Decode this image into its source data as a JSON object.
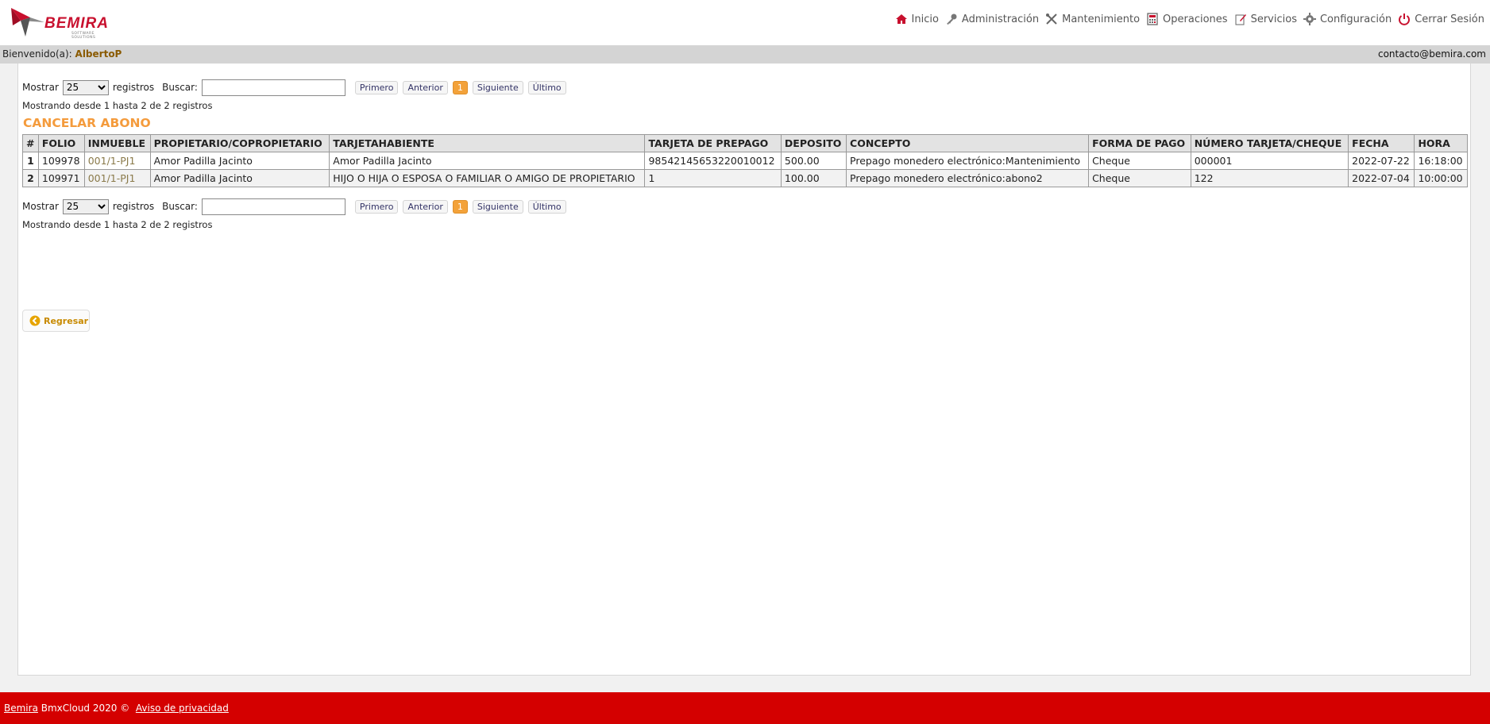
{
  "brand": {
    "logo_text": "BEMIRA",
    "logo_tagline": "SOFTWARE SOLUTIONS",
    "accent": "#c8102e"
  },
  "nav": [
    {
      "label": "Inicio",
      "icon": "home-icon"
    },
    {
      "label": "Administración",
      "icon": "key-icon"
    },
    {
      "label": "Mantenimiento",
      "icon": "tools-icon"
    },
    {
      "label": "Operaciones",
      "icon": "calculator-icon"
    },
    {
      "label": "Servicios",
      "icon": "pencil-doc-icon"
    },
    {
      "label": "Configuración",
      "icon": "gear-icon"
    },
    {
      "label": "Cerrar Sesión",
      "icon": "power-icon"
    }
  ],
  "welcome": {
    "label": "Bienvenido(a):",
    "user": "AlbertoP",
    "contact": "contacto@bemira.com"
  },
  "controls": {
    "show_label": "Mostrar",
    "page_size": "25",
    "records_label": "registros",
    "search_label": "Buscar:",
    "search_value": "",
    "first": "Primero",
    "prev": "Anterior",
    "current_page": "1",
    "next": "Siguiente",
    "last": "Último",
    "info": "Mostrando desde 1 hasta 2 de 2 registros"
  },
  "page_title": "CANCELAR ABONO",
  "table": {
    "headers": [
      "#",
      "FOLIO",
      "INMUEBLE",
      "PROPIETARIO/COPROPIETARIO",
      "TARJETAHABIENTE",
      "TARJETA DE PREPAGO",
      "DEPOSITO",
      "CONCEPTO",
      "FORMA DE PAGO",
      "NÚMERO TARJETA/CHEQUE",
      "FECHA",
      "HORA"
    ],
    "rows": [
      [
        "1",
        "109978",
        "001/1-PJ1",
        "Amor Padilla Jacinto",
        "Amor Padilla Jacinto",
        "98542145653220010012",
        "500.00",
        "Prepago monedero electrónico:Mantenimiento",
        "Cheque",
        "000001",
        "2022-07-22",
        "16:18:00"
      ],
      [
        "2",
        "109971",
        "001/1-PJ1",
        "Amor Padilla Jacinto",
        "HIJO O HIJA O ESPOSA O FAMILIAR O AMIGO DE PROPIETARIO",
        "1",
        "100.00",
        "Prepago monedero electrónico:abono2",
        "Cheque",
        "122",
        "2022-07-04",
        "10:00:00"
      ]
    ]
  },
  "back_button": "Regresar",
  "footer": {
    "brand_link": "Bemira",
    "text": " BmxCloud 2020 © ",
    "privacy": "Aviso de privacidad"
  }
}
